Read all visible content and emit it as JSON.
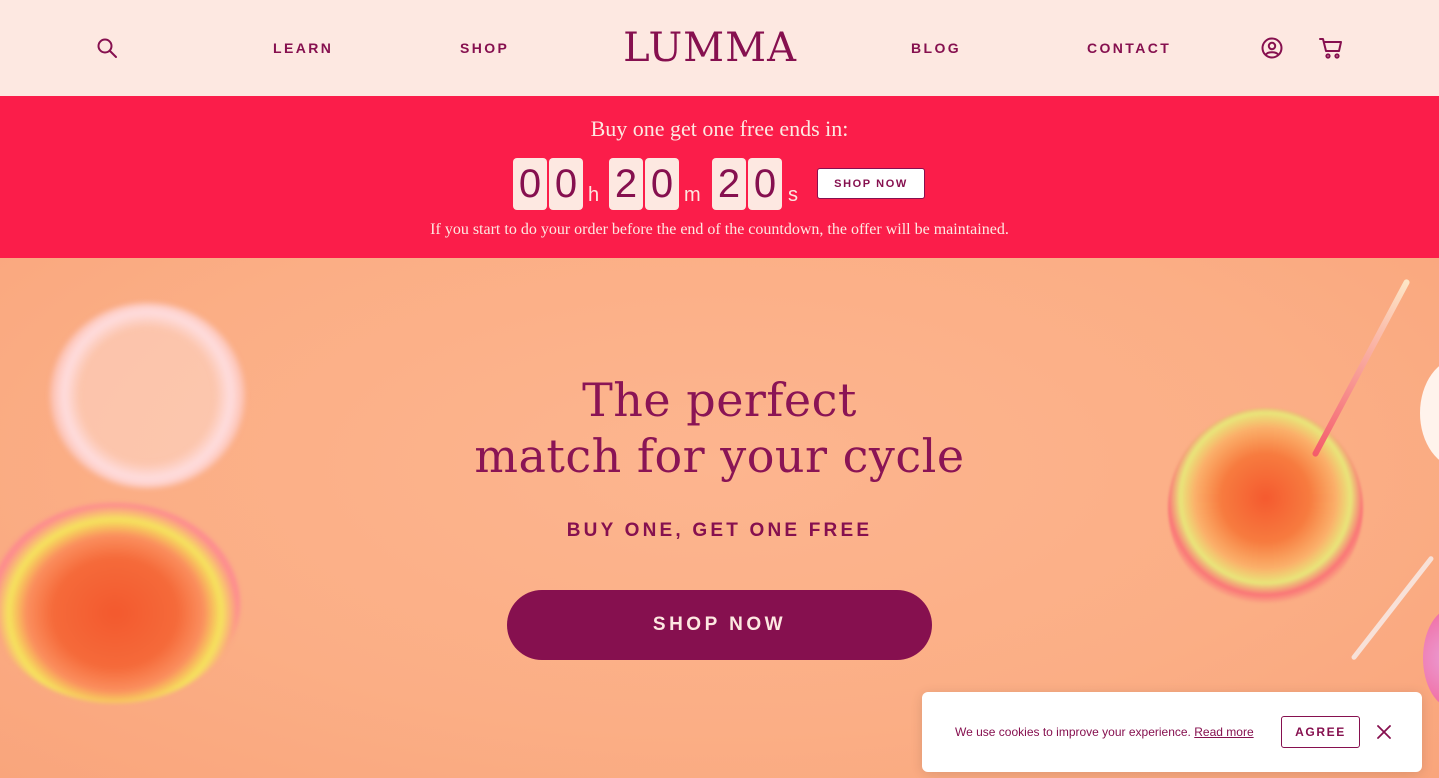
{
  "header": {
    "nav": {
      "learn": "LEARN",
      "shop": "SHOP",
      "blog": "BLOG",
      "contact": "CONTACT"
    },
    "logo_text": "LUMMA",
    "icons": [
      "search-icon",
      "account-icon",
      "cart-icon"
    ]
  },
  "promo": {
    "title": "Buy one get one free ends in:",
    "countdown": {
      "hours": [
        "0",
        "0"
      ],
      "minutes": [
        "2",
        "0"
      ],
      "seconds": [
        "2",
        "0"
      ],
      "unit_h": "h",
      "unit_m": "m",
      "unit_s": "s"
    },
    "button_label": "SHOP NOW",
    "note": "If you start to do your order before the end of the countdown, the offer will be maintained."
  },
  "hero": {
    "title_line1": "The perfect",
    "title_line2": "match for your cycle",
    "subtitle": "BUY ONE, GET ONE FREE",
    "button_label": "SHOP NOW"
  },
  "cookie": {
    "text": "We use cookies to improve your experience.",
    "link": "Read more",
    "agree_label": "AGREE"
  },
  "colors": {
    "header_bg": "#fde8e1",
    "brand": "#86104f",
    "promo_bg": "#fb1d4a",
    "hero_bg": "#fbb088"
  }
}
